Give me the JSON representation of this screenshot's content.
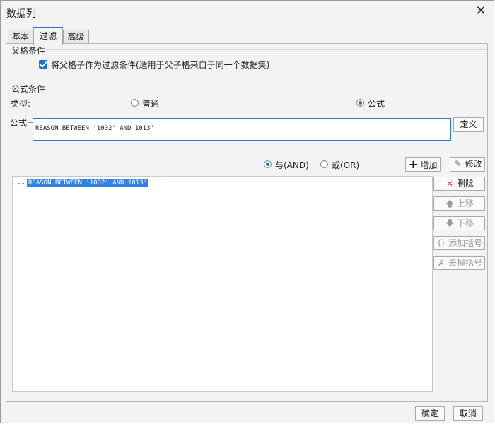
{
  "dialog": {
    "title": "数据列"
  },
  "tabs": [
    "基本",
    "过滤",
    "高级"
  ],
  "parent_cell": {
    "legend": "父格条件",
    "checkbox_label": "将父格子作为过滤条件(适用于父子格来自于同一个数据集)",
    "checked": true
  },
  "formula_condition": {
    "legend": "公式条件",
    "type_label": "类型:",
    "type_options": [
      "普通",
      "公式"
    ],
    "selected_type": "公式",
    "formula_label": "公式=",
    "formula_value": "REASON BETWEEN '1002' AND 1013'",
    "define_button": "定义"
  },
  "logic": {
    "and_label": "与(AND)",
    "or_label": "或(OR)",
    "selected": "AND",
    "add_button": "增加",
    "modify_button": "修改"
  },
  "condition_list": {
    "items": [
      "REASON BETWEEN '1002' AND 1013'"
    ],
    "selected_index": 0
  },
  "side_buttons": {
    "delete": "删除",
    "up": "上移",
    "down": "下移",
    "add_bracket": "添加括号",
    "remove_bracket": "去掉括号"
  },
  "footer": {
    "ok": "确定",
    "cancel": "取消"
  },
  "colors": {
    "accent": "#2f83e6",
    "checkbox": "#1a6ed8",
    "delete_icon": "#e03a2f",
    "add_icon": "#111111"
  }
}
